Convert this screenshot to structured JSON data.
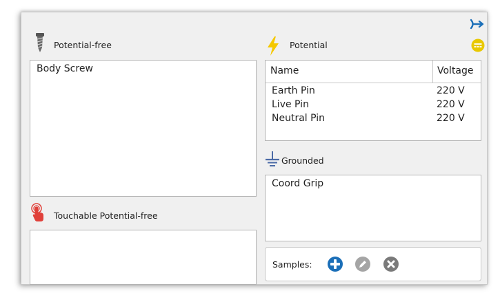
{
  "potential_free": {
    "title": "Potential-free",
    "items": [
      "Body Screw"
    ]
  },
  "potential": {
    "title": "Potential",
    "columns": [
      "Name",
      "Voltage"
    ],
    "rows": [
      {
        "name": "Earth Pin",
        "voltage": "220 V"
      },
      {
        "name": "Live Pin",
        "voltage": "220 V"
      },
      {
        "name": "Neutral Pin",
        "voltage": "220 V"
      }
    ]
  },
  "grounded": {
    "title": "Grounded",
    "items": [
      "Coord Grip"
    ]
  },
  "touchable": {
    "title": "Touchable Potential-free",
    "items": []
  },
  "samples": {
    "label": "Samples:"
  },
  "icons": {
    "screw": "screw-icon",
    "lightning": "lightning-icon",
    "ground": "ground-icon",
    "touch": "touch-icon",
    "connector": "connector-icon",
    "dc": "dc-icon",
    "add": "plus-icon",
    "edit": "pencil-icon",
    "remove": "close-icon"
  },
  "colors": {
    "panel_bg": "#f0f0f0",
    "blue": "#1b6fb8",
    "yellow": "#f5c800",
    "ground_blue": "#4a6aa6",
    "touch_red": "#e0403a",
    "gray": "#9b9b9b",
    "dark_gray": "#757575"
  }
}
